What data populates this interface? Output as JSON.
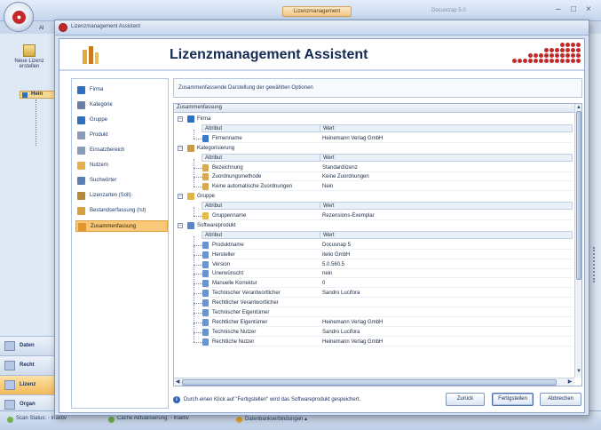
{
  "app": {
    "title": "Lizenzmanagement",
    "right_title": "Docuscrap 5.0",
    "quick_access_label": "Al",
    "new_license_label": "Neue Lizenz erstellen",
    "tree_node": "Hein",
    "nav": [
      "Daten",
      "Recht",
      "Lizenz",
      "Organ"
    ]
  },
  "wizard": {
    "window_title": "Lizenzmanagement Assistent",
    "header_title": "Lizenzmanagement Assistent",
    "steps": [
      {
        "label": "Firma",
        "icon": "building-icon",
        "color": "#2f6fc0"
      },
      {
        "label": "Kategorie",
        "icon": "category-icon",
        "color": "#6b7fa3"
      },
      {
        "label": "Gruppe",
        "icon": "group-icon",
        "color": "#2f6fc0"
      },
      {
        "label": "Produkt",
        "icon": "product-icon",
        "color": "#8a9bb8"
      },
      {
        "label": "Einsatzbereich",
        "icon": "usage-icon",
        "color": "#8a9bb8"
      },
      {
        "label": "Nutzern",
        "icon": "user-icon",
        "color": "#e4b04a"
      },
      {
        "label": "Suchwörter",
        "icon": "keyword-icon",
        "color": "#5a7fb5"
      },
      {
        "label": "Lizenzarten (Soll)",
        "icon": "license-icon",
        "color": "#b38a3a"
      },
      {
        "label": "Bestandserfassung (Ist)",
        "icon": "inventory-icon",
        "color": "#d4a13b"
      },
      {
        "label": "Zusammenfassung",
        "icon": "summary-icon",
        "color": "#e2952f"
      }
    ],
    "selected_step": 9,
    "description": "Zusammenfassende Darstellung der gewählten Optionen",
    "summary_header": "Zusammenfassung",
    "col_attr": "Attribut",
    "col_value": "Wert",
    "groups": [
      {
        "label": "Firma",
        "icon": "building-icon",
        "color": "#2f6fc0",
        "item_color": "#3d77c8",
        "rows": [
          {
            "k": "Firmenname",
            "v": "Heinemann Verlag GmbH"
          }
        ]
      },
      {
        "label": "Kategorisierung",
        "icon": "category-icon",
        "color": "#c99a45",
        "item_color": "#d8a955",
        "rows": [
          {
            "k": "Bezeichnung",
            "v": "Standardlizenz"
          },
          {
            "k": "Zuordnungsmethode",
            "v": "Keine Zuordnungen"
          },
          {
            "k": "Keine automatische Zuordnungen",
            "v": "Nein"
          }
        ]
      },
      {
        "label": "Gruppe",
        "icon": "group-icon",
        "color": "#e0b24a",
        "item_color": "#e6bb4e",
        "rows": [
          {
            "k": "Gruppenname",
            "v": "Rezensions-Exemplar"
          }
        ]
      },
      {
        "label": "Softwareprodukt",
        "icon": "product-icon",
        "color": "#5a86c4",
        "item_color": "#6b93cc",
        "rows": [
          {
            "k": "Produktname",
            "v": "Docusnap 5"
          },
          {
            "k": "Hersteller",
            "v": "itelio GmbH"
          },
          {
            "k": "Version",
            "v": "5.0.560.5"
          },
          {
            "k": "Unerwünscht",
            "v": "nein"
          },
          {
            "k": "Manuelle Korrektur",
            "v": "0"
          },
          {
            "k": "Technischer Verantwortlicher",
            "v": "Sandro Lucifora"
          },
          {
            "k": "Rechtlicher Verantwortlicher",
            "v": ""
          },
          {
            "k": "Technischer Eigentümer",
            "v": ""
          },
          {
            "k": "Rechtlicher Eigentümer",
            "v": "Heinemann Verlag GmbH"
          },
          {
            "k": "Technische Nutzer",
            "v": "Sandro Lucifora"
          },
          {
            "k": "Rechtliche Nutzer",
            "v": "Heinemann Verlag GmbH"
          }
        ]
      }
    ],
    "info_text": "Durch einen Klick auf \"Fertigstellen\" wird das Softwareprodukt gespeichert.",
    "buttons": {
      "back": "Zurück",
      "finish": "Fertigstellen",
      "cancel": "Abbrechen"
    }
  },
  "status": [
    {
      "label": "Scan Status: ◦ Inaktiv",
      "warn": false
    },
    {
      "label": "Cache Aktualisierung: ◦ Inaktiv",
      "warn": false
    },
    {
      "label": "Datenbankverbindungen ▴",
      "warn": true
    }
  ]
}
